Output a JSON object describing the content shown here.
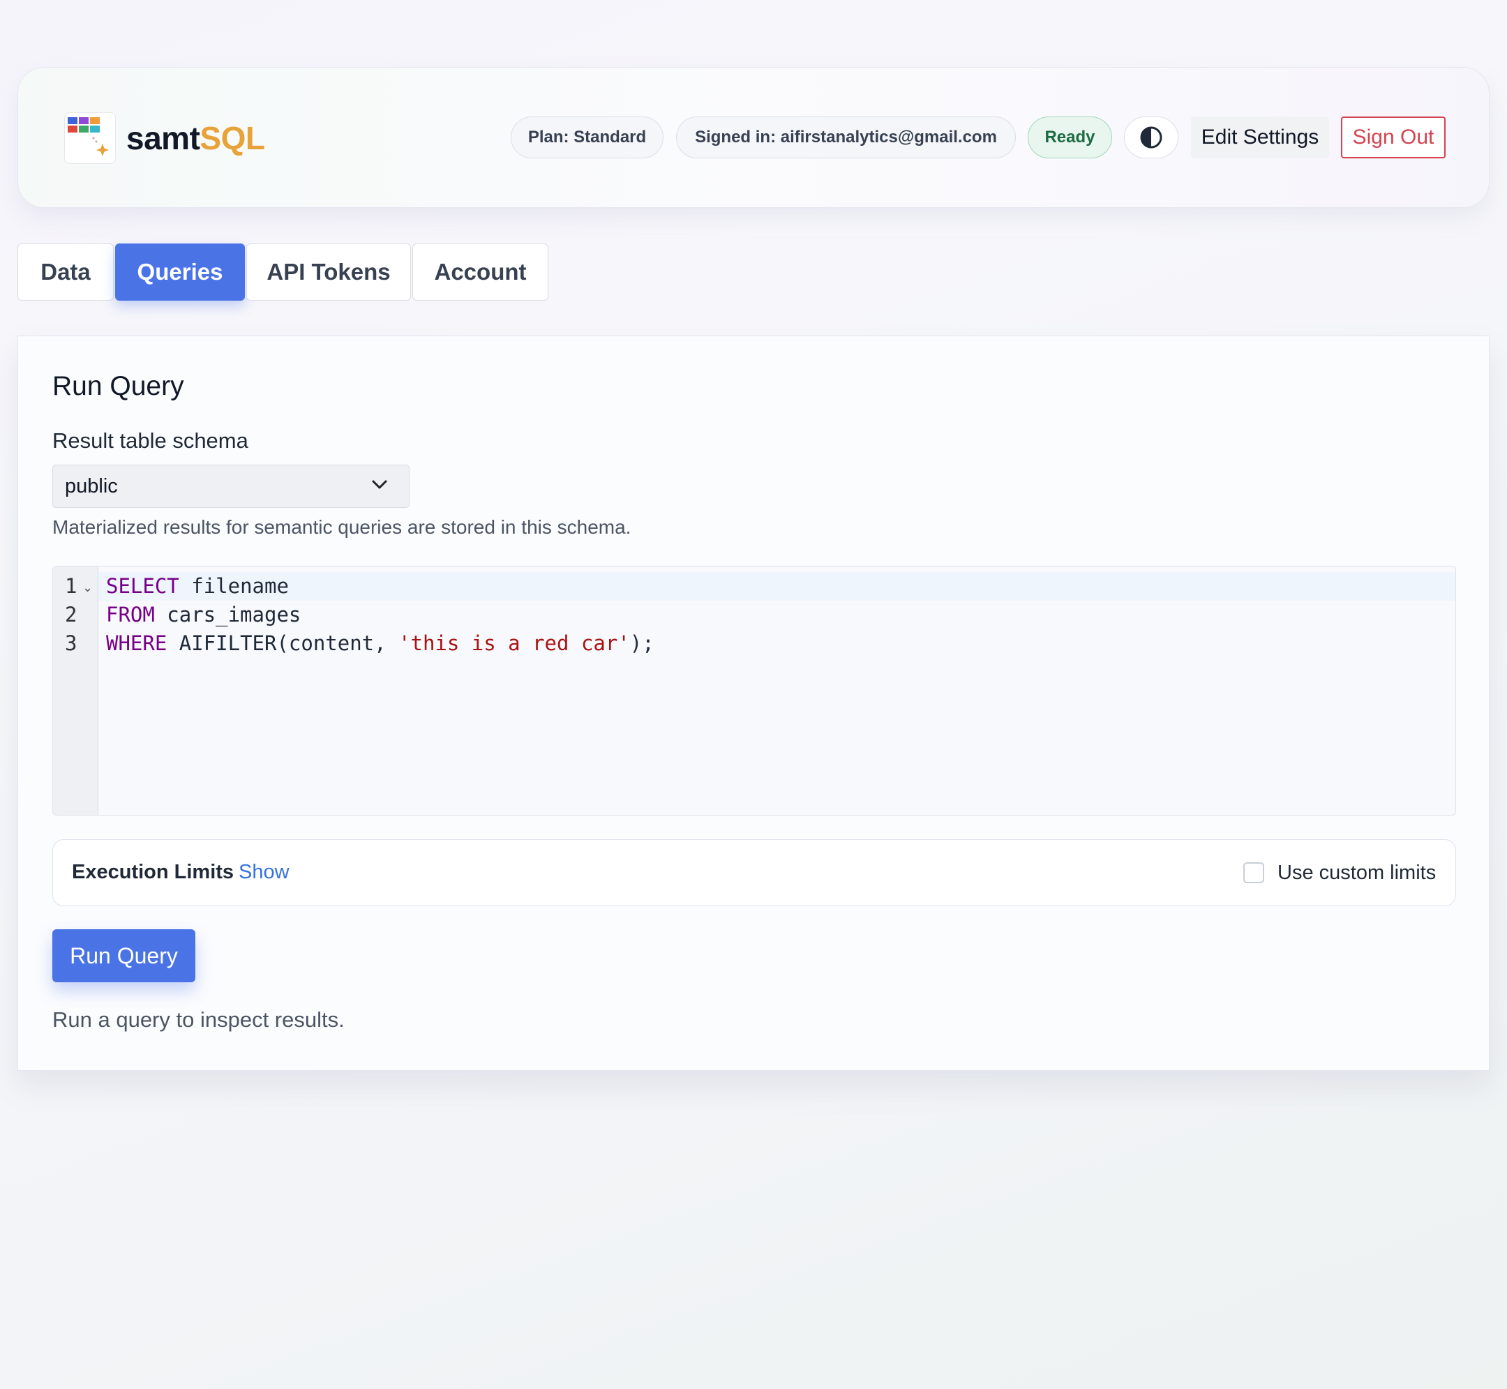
{
  "header": {
    "brand_main": "samt",
    "brand_accent": "SQL",
    "plan": "Plan: Standard",
    "signed_in": "Signed in: aifirstanalytics@gmail.com",
    "status": "Ready",
    "edit_settings": "Edit Settings",
    "sign_out": "Sign Out"
  },
  "tabs": [
    {
      "label": "Data",
      "active": false
    },
    {
      "label": "Queries",
      "active": true
    },
    {
      "label": "API Tokens",
      "active": false
    },
    {
      "label": "Account",
      "active": false
    }
  ],
  "panel": {
    "title": "Run Query",
    "schema_label": "Result table schema",
    "schema_selected": "public",
    "schema_helper": "Materialized results for semantic queries are stored in this schema.",
    "editor": {
      "line_numbers": [
        "1",
        "2",
        "3"
      ],
      "lines": [
        {
          "keyword": "SELECT",
          "rest": " filename"
        },
        {
          "keyword": "FROM",
          "rest": " cars_images"
        },
        {
          "keyword": "WHERE",
          "rest": " AIFILTER(content, ",
          "string": "'this is a red car'",
          "tail": ");"
        }
      ]
    },
    "limits": {
      "title": "Execution Limits",
      "toggle": "Show",
      "checkbox_label": "Use custom limits",
      "checked": false
    },
    "run_button": "Run Query",
    "run_hint": "Run a query to inspect results."
  },
  "icons": {
    "logo": "grid-sparkle-logo-icon",
    "theme": "contrast-half-circle-icon",
    "dropdown": "chevron-down-icon",
    "fold": "fold-arrow-icon"
  },
  "colors": {
    "accent": "#4a74e6",
    "brand_accent": "#e8a23a",
    "danger": "#d4434f",
    "ready": "#1d6b43",
    "keyword": "#770088",
    "string": "#aa1111"
  }
}
